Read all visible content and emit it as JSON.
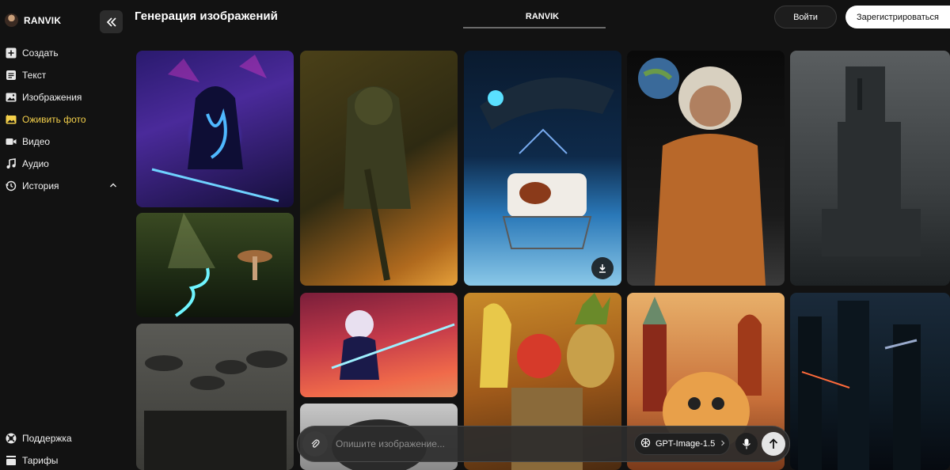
{
  "brand": {
    "name": "RANVIK"
  },
  "sidebar": {
    "items": [
      {
        "label": "Создать",
        "icon": "plus-square-icon"
      },
      {
        "label": "Текст",
        "icon": "text-doc-icon"
      },
      {
        "label": "Изображения",
        "icon": "image-icon"
      },
      {
        "label": "Оживить фото",
        "icon": "animate-photo-icon",
        "active": true
      },
      {
        "label": "Видео",
        "icon": "video-camera-icon"
      },
      {
        "label": "Аудио",
        "icon": "music-note-icon"
      },
      {
        "label": "История",
        "icon": "history-clock-icon",
        "expanded": true
      }
    ],
    "bottom": [
      {
        "label": "Поддержка",
        "icon": "support-icon"
      },
      {
        "label": "Тарифы",
        "icon": "tariffs-icon"
      }
    ]
  },
  "header": {
    "title": "Генерация изображений",
    "center_tab": "RANVIK",
    "login_label": "Войти",
    "register_label": "Зарегистрироваться"
  },
  "gallery": {
    "images": [
      {
        "subject": "neon samurai cyborg in city"
      },
      {
        "subject": "stone knight statue at sunset"
      },
      {
        "subject": "cow lifted by spaceship over earth"
      },
      {
        "subject": "cosmonaut on moon"
      },
      {
        "subject": "brutalist concrete tower"
      },
      {
        "subject": "glowing forest stream with mushrooms"
      },
      {
        "subject": "anime girl with glowing sword"
      },
      {
        "subject": "fruit warriors"
      },
      {
        "subject": "cartoon puppy in Red Square"
      },
      {
        "subject": "futuristic night city"
      },
      {
        "subject": "boys in flat caps"
      },
      {
        "subject": "robot helmet"
      }
    ]
  },
  "prompt": {
    "placeholder": "Опишите изображение...",
    "model_label": "GPT-Image-1.5"
  },
  "colors": {
    "background": "#121212",
    "accent_active": "#f3cf4a",
    "register_bg": "#ffffff"
  }
}
